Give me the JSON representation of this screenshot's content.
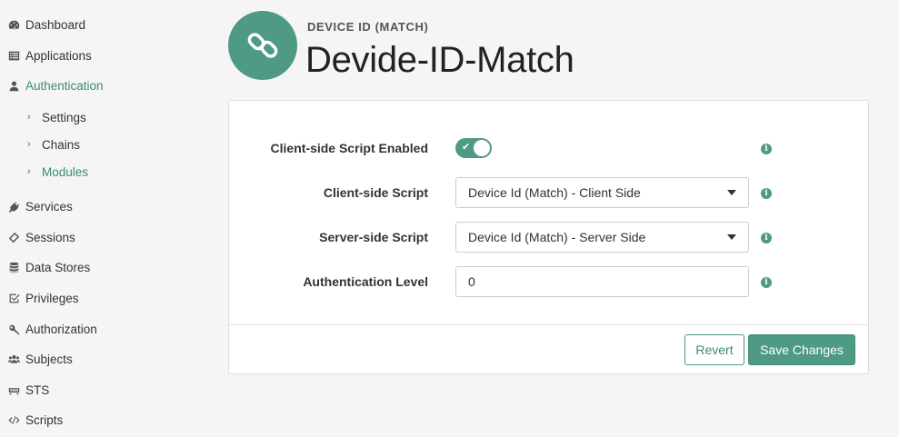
{
  "sidebar": {
    "items": [
      {
        "label": "Dashboard",
        "icon": "dashboard-icon"
      },
      {
        "label": "Applications",
        "icon": "list-icon"
      },
      {
        "label": "Authentication",
        "icon": "user-icon"
      },
      {
        "label": "Services",
        "icon": "plug-icon"
      },
      {
        "label": "Sessions",
        "icon": "ticket-icon"
      },
      {
        "label": "Data Stores",
        "icon": "database-icon"
      },
      {
        "label": "Privileges",
        "icon": "checkbox-icon"
      },
      {
        "label": "Authorization",
        "icon": "key-icon"
      },
      {
        "label": "Subjects",
        "icon": "users-icon"
      },
      {
        "label": "STS",
        "icon": "sts-icon"
      },
      {
        "label": "Scripts",
        "icon": "code-icon"
      }
    ],
    "sub_items": [
      {
        "label": "Settings"
      },
      {
        "label": "Chains"
      },
      {
        "label": "Modules"
      }
    ],
    "active_item": "Authentication",
    "active_sub_item": "Modules",
    "accent_color": "#3d8a73"
  },
  "header": {
    "subtitle": "DEVICE ID (MATCH)",
    "title": "Devide-ID-Match",
    "icon": "link-icon"
  },
  "form": {
    "client_script_enabled": {
      "label": "Client-side Script Enabled",
      "value": true
    },
    "client_script": {
      "label": "Client-side Script",
      "value": "Device Id (Match) - Client Side"
    },
    "server_script": {
      "label": "Server-side Script",
      "value": "Device Id (Match) - Server Side"
    },
    "auth_level": {
      "label": "Authentication Level",
      "value": "0"
    }
  },
  "actions": {
    "revert_label": "Revert",
    "save_label": "Save Changes"
  },
  "colors": {
    "brand": "#4e9a85",
    "background": "#f5f5f5"
  }
}
